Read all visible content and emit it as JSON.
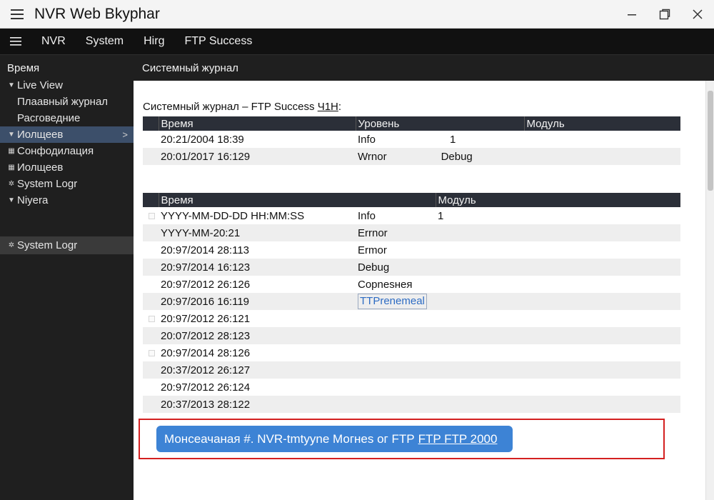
{
  "window": {
    "title": "NVR Web Bkyphar"
  },
  "menu": {
    "items": [
      "NVR",
      "System",
      "Hirg",
      "FTP Success"
    ]
  },
  "sidebar": {
    "heading": "Время",
    "items": [
      {
        "label": "Live View",
        "icon": "triangle-down-icon"
      },
      {
        "label": "Плаавный журнал",
        "sub": true
      },
      {
        "label": "Расговедние",
        "sub": true
      },
      {
        "label": "Иолщеев",
        "icon": "triangle-down-icon",
        "active": true
      },
      {
        "label": "Сонфодилация",
        "icon": "grid-icon"
      },
      {
        "label": "Иолщеев",
        "icon": "grid-icon"
      },
      {
        "label": "System Logr",
        "icon": "gear-icon"
      },
      {
        "label": "Niyera",
        "icon": "triangle-down-icon"
      }
    ],
    "selected_item": "System Logr"
  },
  "main": {
    "header": "Системный журнал",
    "log_title": "Системный журнал – FTP Success ",
    "log_title_suffix": "Ч1Н",
    "log_title_colon": ":",
    "table1": {
      "headers": [
        "Время",
        "Уровень",
        "Модуль"
      ],
      "rows": [
        {
          "time": "20:21/2004 18:39",
          "level": "Info",
          "extra": "1"
        },
        {
          "time": "20:01/2017 16:129",
          "level": "Wrnor",
          "extra": "Debug"
        }
      ]
    },
    "table2": {
      "headers": [
        "Время",
        "Модуль"
      ],
      "rows": [
        {
          "time": "YYYY-MM-DD-DD HH:MM:SS",
          "level": "Info",
          "module": "1"
        },
        {
          "time": "YYYY-MM-20:21",
          "level": "Errnor",
          "module": ""
        },
        {
          "time": "20:97/2014 28:113",
          "level": "Ermor",
          "module": ""
        },
        {
          "time": "20:97/2014 16:123",
          "level": "Debug",
          "module": ""
        },
        {
          "time": "20:97/2012 26:126",
          "level": "Сорnesнея",
          "module": ""
        },
        {
          "time": "20:97/2016 16:119",
          "level": "TTPrenemeal",
          "module": ""
        },
        {
          "time": "20:97/2012 26:121",
          "level": "",
          "module": ""
        },
        {
          "time": "20:07/2012 28:123",
          "level": "",
          "module": ""
        },
        {
          "time": "20:97/2014 28:126",
          "level": "",
          "module": ""
        },
        {
          "time": "20:37/2012 26:127",
          "level": "",
          "module": ""
        },
        {
          "time": "20:97/2012 26:124",
          "level": "",
          "module": ""
        },
        {
          "time": "20:37/2013 28:122",
          "level": "",
          "module": ""
        }
      ]
    }
  },
  "notification": {
    "text": "Монсеачаная #. NVR-tmtyyne Могнеs ог FTP",
    "link": "FTP FTP 2000"
  },
  "colors": {
    "accent": "#3d83d5",
    "highlight_border": "#d42020",
    "table_header": "#2b2f38",
    "sidebar_active": "#3c4f6a"
  }
}
